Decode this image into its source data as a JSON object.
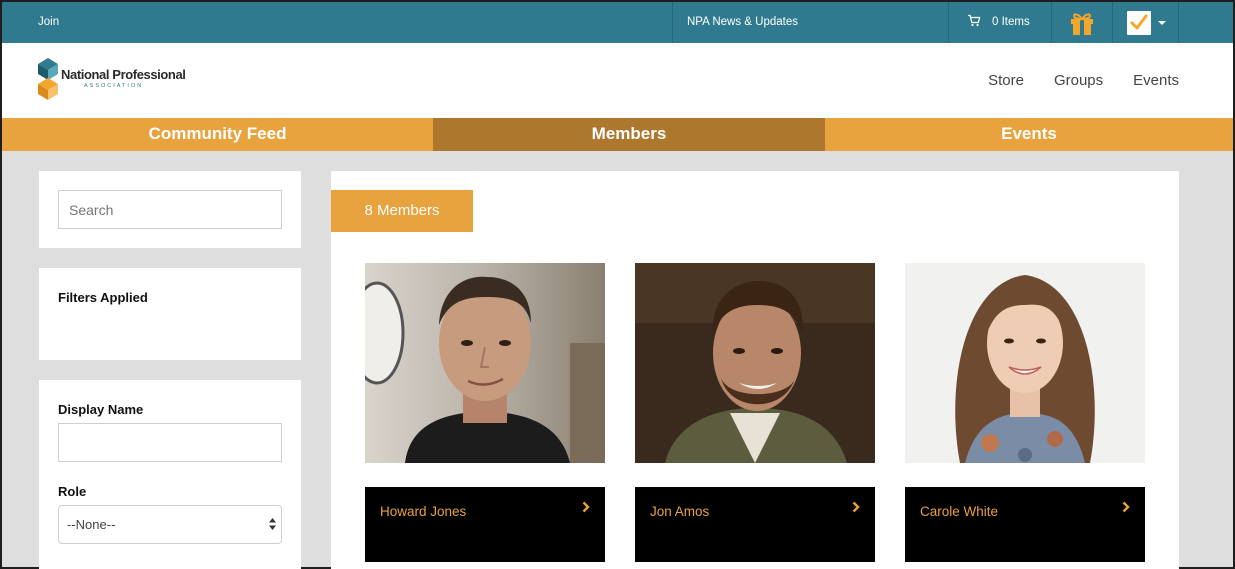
{
  "topbar": {
    "join": "Join",
    "news": "NPA News & Updates",
    "cart_label": "0 Items"
  },
  "brand": {
    "name": "National Professional",
    "sub": "ASSOCIATION"
  },
  "nav": [
    "Store",
    "Groups",
    "Events"
  ],
  "tabs": [
    {
      "label": "Community Feed",
      "active": false
    },
    {
      "label": "Members",
      "active": true
    },
    {
      "label": "Events",
      "active": false
    }
  ],
  "sidebar": {
    "search_placeholder": "Search",
    "filters_title": "Filters Applied",
    "display_name_label": "Display Name",
    "role_label": "Role",
    "role_value": "--None--"
  },
  "members": {
    "count_label": "8 Members",
    "items": [
      {
        "name": "Howard Jones"
      },
      {
        "name": "Jon Amos"
      },
      {
        "name": "Carole White"
      }
    ]
  },
  "colors": {
    "teal": "#2f7a8e",
    "orange": "#e8a23e",
    "active_tab": "#ad782e"
  }
}
